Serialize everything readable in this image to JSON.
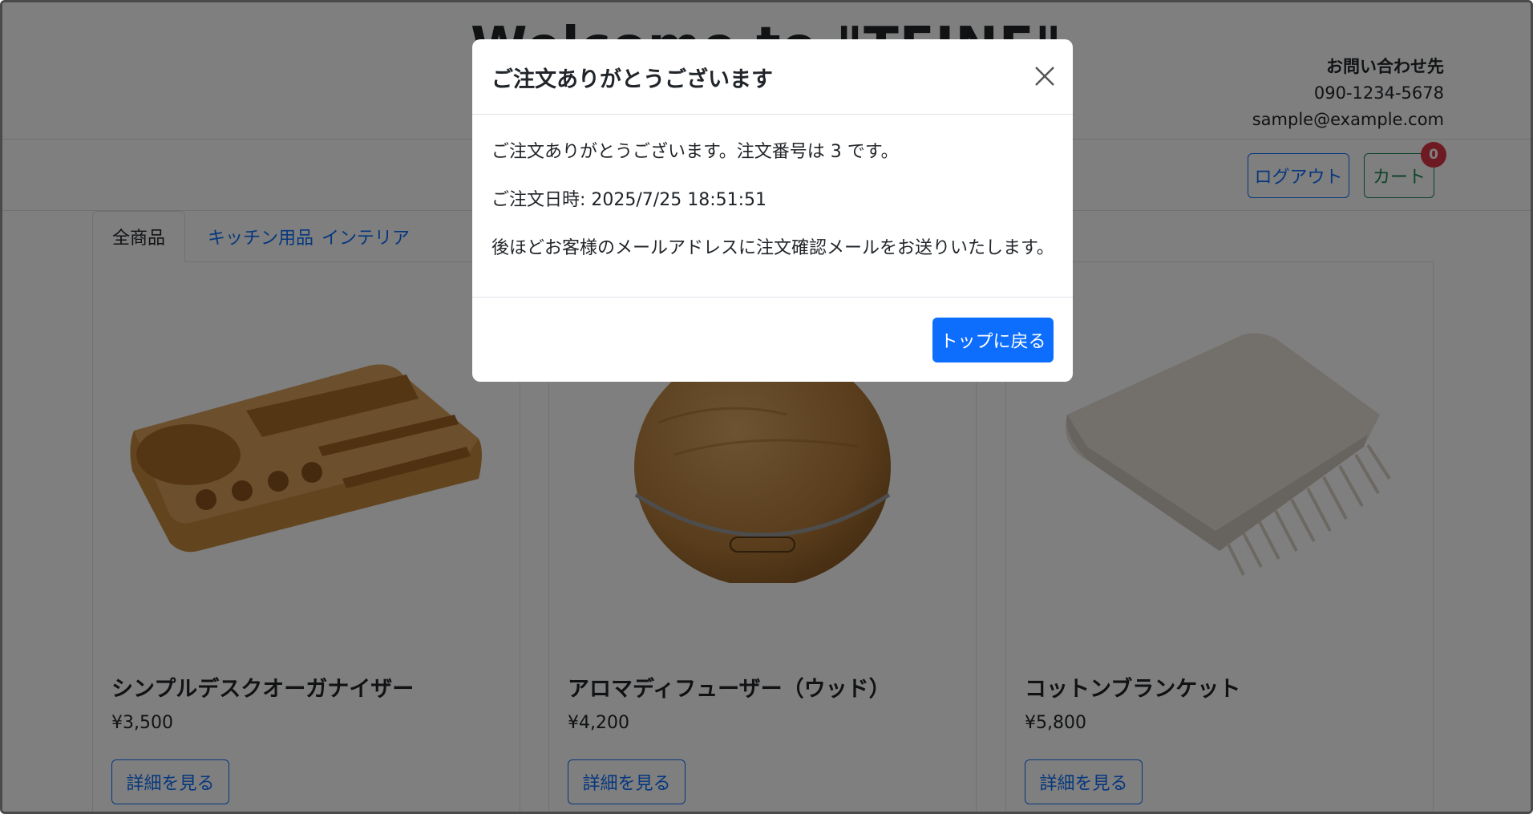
{
  "header": {
    "site_title": "Welcome to \"TEINE\"",
    "contact_heading": "お問い合わせ先",
    "contact_phone": "090-1234-5678",
    "contact_email": "sample@example.com"
  },
  "nav": {
    "logout_label": "ログアウト",
    "cart_label": "カート",
    "cart_count": "0"
  },
  "tabs": [
    {
      "label": "全商品",
      "active": true
    },
    {
      "label": "キッチン用品",
      "active": false
    },
    {
      "label": "インテリア",
      "active": false
    }
  ],
  "products": [
    {
      "name": "シンプルデスクオーガナイザー",
      "price": "¥3,500",
      "detail_label": "詳細を見る",
      "image": "desk-organizer"
    },
    {
      "name": "アロマディフューザー（ウッド）",
      "price": "¥4,200",
      "detail_label": "詳細を見る",
      "image": "aroma-diffuser"
    },
    {
      "name": "コットンブランケット",
      "price": "¥5,800",
      "detail_label": "詳細を見る",
      "image": "cotton-blanket"
    }
  ],
  "modal": {
    "title": "ご注文ありがとうございます",
    "message_prefix": "ご注文ありがとうございます。注文番号は ",
    "order_number": "3",
    "message_suffix": " です。",
    "order_date": "ご注文日時: 2025/7/25 18:51:51",
    "email_notice": "後ほどお客様のメールアドレスに注文確認メールをお送りいたします。",
    "back_button_label": "トップに戻る",
    "close_icon": "close-icon"
  },
  "colors": {
    "primary": "#0d6efd",
    "success": "#198754",
    "danger": "#dc3545",
    "backdrop": "rgba(0,0,0,0.5)"
  }
}
